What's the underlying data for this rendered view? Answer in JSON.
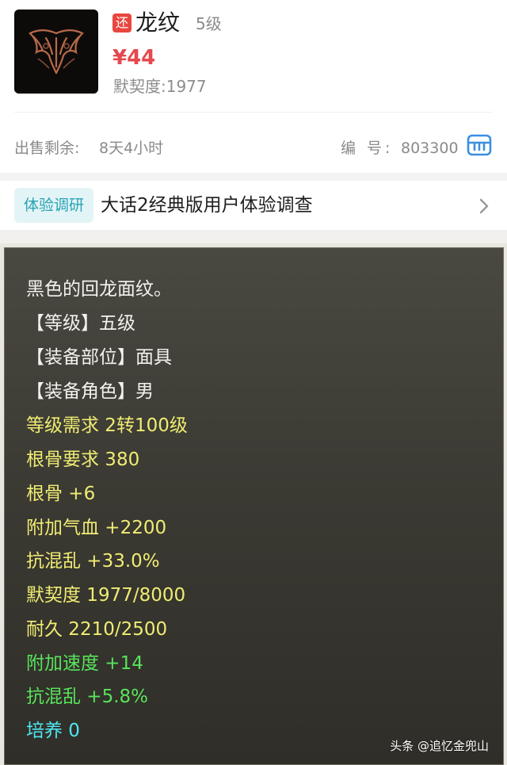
{
  "item": {
    "return_badge": "还",
    "name": "龙纹",
    "level": "5级",
    "price": "¥44",
    "tacit": "默契度:1977",
    "thumbnail_icon": "dragon-mask-icon"
  },
  "sale": {
    "remain_label": "出售剩余:",
    "remain_value": "8天4小时",
    "serial_label": "编 号:",
    "serial_value": "803300",
    "copy_icon": "copy-icon"
  },
  "survey": {
    "tag": "体验调研",
    "title": "大话2经典版用户体验调查",
    "chevron_icon": "chevron-right-icon"
  },
  "tooltip": {
    "lines": [
      "黑色的回龙面纹。",
      "【等级】五级",
      "【装备部位】面具",
      "【装备角色】男",
      "等级需求 2转100级",
      "根骨要求 380",
      "根骨 +6",
      "附加气血 +2200",
      "抗混乱 +33.0%",
      "默契度 1977/8000",
      "耐久 2210/2500",
      "附加速度 +14",
      "抗混乱 +5.8%",
      "培养 0"
    ]
  },
  "watermark": "头条 @追忆金兜山",
  "colors": {
    "price": "#e5484d",
    "badge": "#e8473f",
    "survey_tag_text": "#2aa3b5",
    "survey_tag_bg": "#e2f4f6",
    "copy_icon": "#3b8fe0",
    "text_white": "#f2f2ee",
    "text_yellow": "#f0ec73",
    "text_green": "#58e35c",
    "text_cyan": "#4fe7f2"
  }
}
